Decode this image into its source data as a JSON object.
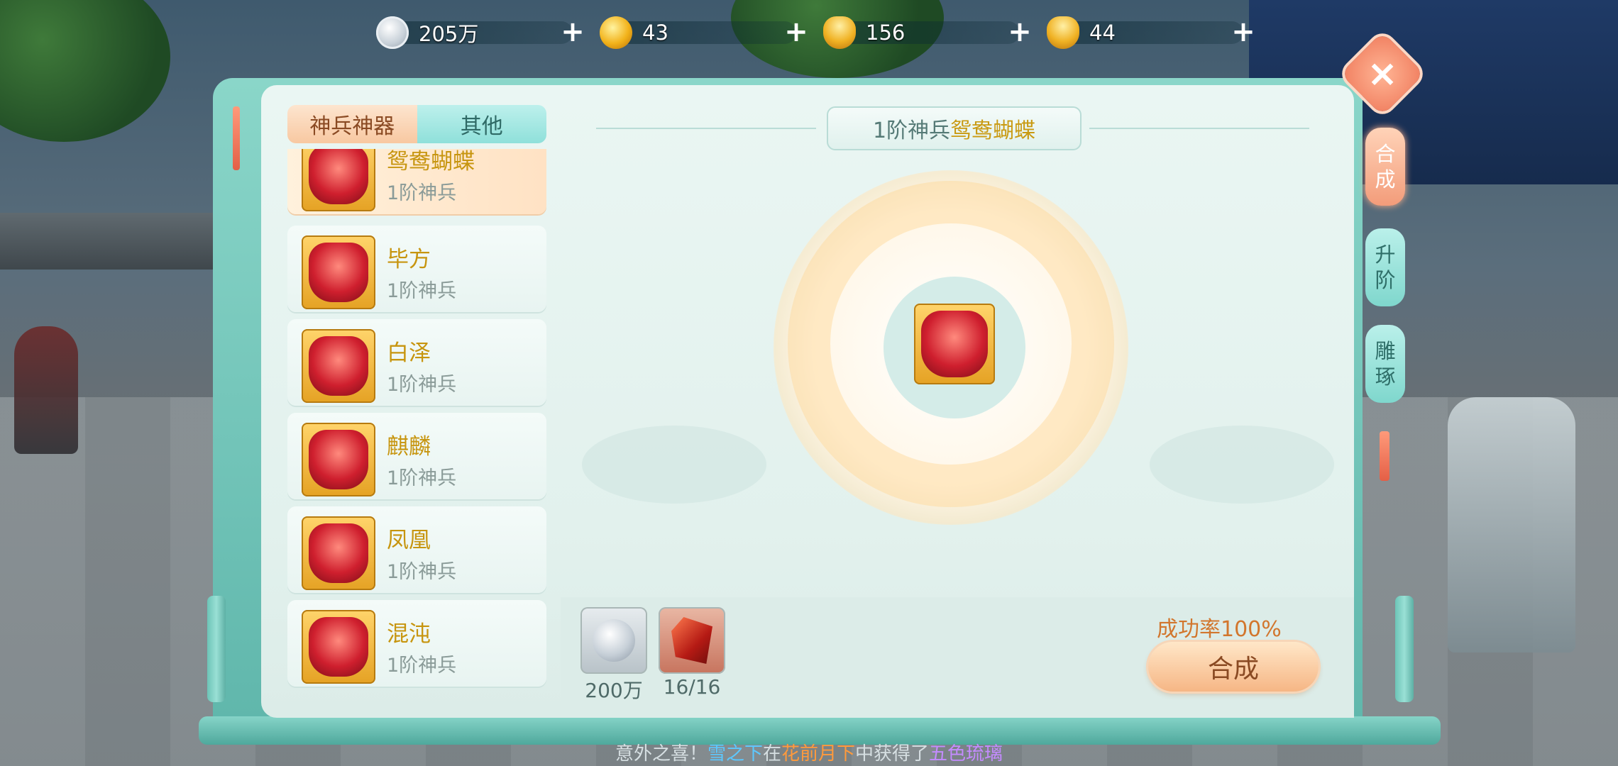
{
  "currencies": [
    {
      "name": "silver-coin",
      "value": "205万"
    },
    {
      "name": "gold-coin",
      "value": "43"
    },
    {
      "name": "gold-ingot-ribbon",
      "value": "156"
    },
    {
      "name": "gold-ingot",
      "value": "44"
    }
  ],
  "tabs": {
    "active": "神兵神器",
    "other": "其他"
  },
  "list": [
    {
      "name": "鸳鸯蝴蝶",
      "grade": "1阶神兵"
    },
    {
      "name": "毕方",
      "grade": "1阶神兵"
    },
    {
      "name": "白泽",
      "grade": "1阶神兵"
    },
    {
      "name": "麒麟",
      "grade": "1阶神兵"
    },
    {
      "name": "凤凰",
      "grade": "1阶神兵"
    },
    {
      "name": "混沌",
      "grade": "1阶神兵"
    }
  ],
  "title": {
    "grade": "1阶神兵",
    "name": "鸳鸯蝴蝶"
  },
  "materials": [
    {
      "type": "silver-coin",
      "label": "200万"
    },
    {
      "type": "red-crystal",
      "label": "16/16"
    }
  ],
  "success_rate": "成功率100%",
  "compose_button": "合成",
  "side_tabs": {
    "compose": [
      "合",
      "成"
    ],
    "upgrade": [
      "升",
      "阶"
    ],
    "carve": [
      "雕",
      "琢"
    ]
  },
  "close_icon": "×",
  "ticker": {
    "part1": "意外之喜！",
    "player": "雪之下",
    "part2": "在",
    "place": "花前月下",
    "part3": "中获得了",
    "item": "五色琉璃"
  },
  "colors": {
    "accent_gold": "#c99a12",
    "accent_orange": "#d2762d",
    "panel_teal": "#8ad6c9"
  }
}
